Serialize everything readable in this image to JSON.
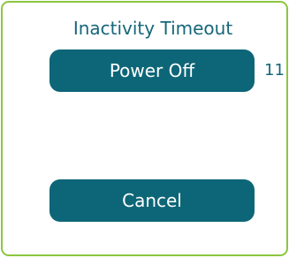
{
  "dialog": {
    "title": "Inactivity Timeout",
    "power_off_label": "Power Off",
    "countdown": "11",
    "cancel_label": "Cancel"
  },
  "colors": {
    "border": "#8cc63f",
    "button_bg": "#0d6677",
    "text_teal": "#15677a"
  }
}
